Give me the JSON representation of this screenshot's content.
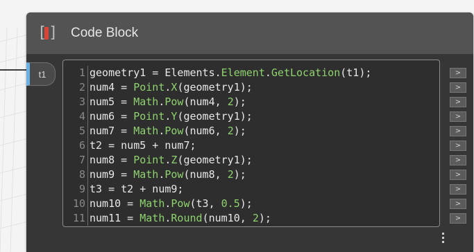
{
  "node": {
    "title": "Code Block",
    "icon": "code-block-icon",
    "input_port": "t1",
    "accent_color": "#d9443a",
    "port_color": "#6ab0e0"
  },
  "code_lines": [
    {
      "n": "1",
      "tokens": [
        {
          "t": "txt",
          "v": "geometry1 = Elements."
        },
        {
          "t": "cls",
          "v": "Element"
        },
        {
          "t": "txt",
          "v": "."
        },
        {
          "t": "cls",
          "v": "GetLocation"
        },
        {
          "t": "txt",
          "v": "(t1);"
        }
      ]
    },
    {
      "n": "2",
      "tokens": [
        {
          "t": "txt",
          "v": "num4 = "
        },
        {
          "t": "cls",
          "v": "Point"
        },
        {
          "t": "txt",
          "v": "."
        },
        {
          "t": "cls",
          "v": "X"
        },
        {
          "t": "txt",
          "v": "(geometry1);"
        }
      ]
    },
    {
      "n": "3",
      "tokens": [
        {
          "t": "txt",
          "v": "num5 = "
        },
        {
          "t": "cls",
          "v": "Math"
        },
        {
          "t": "txt",
          "v": "."
        },
        {
          "t": "cls",
          "v": "Pow"
        },
        {
          "t": "txt",
          "v": "(num4, "
        },
        {
          "t": "num",
          "v": "2"
        },
        {
          "t": "txt",
          "v": ");"
        }
      ]
    },
    {
      "n": "4",
      "tokens": [
        {
          "t": "txt",
          "v": "num6 = "
        },
        {
          "t": "cls",
          "v": "Point"
        },
        {
          "t": "txt",
          "v": "."
        },
        {
          "t": "cls",
          "v": "Y"
        },
        {
          "t": "txt",
          "v": "(geometry1);"
        }
      ]
    },
    {
      "n": "5",
      "tokens": [
        {
          "t": "txt",
          "v": "num7 = "
        },
        {
          "t": "cls",
          "v": "Math"
        },
        {
          "t": "txt",
          "v": "."
        },
        {
          "t": "cls",
          "v": "Pow"
        },
        {
          "t": "txt",
          "v": "(num6, "
        },
        {
          "t": "num",
          "v": "2"
        },
        {
          "t": "txt",
          "v": ");"
        }
      ]
    },
    {
      "n": "6",
      "tokens": [
        {
          "t": "txt",
          "v": "t2 = num5 + num7;"
        }
      ]
    },
    {
      "n": "7",
      "tokens": [
        {
          "t": "txt",
          "v": "num8 = "
        },
        {
          "t": "cls",
          "v": "Point"
        },
        {
          "t": "txt",
          "v": "."
        },
        {
          "t": "cls",
          "v": "Z"
        },
        {
          "t": "txt",
          "v": "(geometry1);"
        }
      ]
    },
    {
      "n": "8",
      "tokens": [
        {
          "t": "txt",
          "v": "num9 = "
        },
        {
          "t": "cls",
          "v": "Math"
        },
        {
          "t": "txt",
          "v": "."
        },
        {
          "t": "cls",
          "v": "Pow"
        },
        {
          "t": "txt",
          "v": "(num8, "
        },
        {
          "t": "num",
          "v": "2"
        },
        {
          "t": "txt",
          "v": ");"
        }
      ]
    },
    {
      "n": "9",
      "tokens": [
        {
          "t": "txt",
          "v": "t3 = t2 + num9;"
        }
      ]
    },
    {
      "n": "10",
      "tokens": [
        {
          "t": "txt",
          "v": "num10 = "
        },
        {
          "t": "cls",
          "v": "Math"
        },
        {
          "t": "txt",
          "v": "."
        },
        {
          "t": "cls",
          "v": "Pow"
        },
        {
          "t": "txt",
          "v": "(t3, "
        },
        {
          "t": "num",
          "v": "0.5"
        },
        {
          "t": "txt",
          "v": ");"
        }
      ]
    },
    {
      "n": "11",
      "tokens": [
        {
          "t": "txt",
          "v": "num11 = "
        },
        {
          "t": "cls",
          "v": "Math"
        },
        {
          "t": "txt",
          "v": "."
        },
        {
          "t": "cls",
          "v": "Round"
        },
        {
          "t": "txt",
          "v": "(num10, "
        },
        {
          "t": "num",
          "v": "2"
        },
        {
          "t": "txt",
          "v": ");"
        }
      ]
    }
  ],
  "output_ports": [
    ">",
    ">",
    ">",
    ">",
    ">",
    ">",
    ">",
    ">",
    ">",
    ">",
    ">"
  ],
  "menu_icon": "more-vertical-icon"
}
